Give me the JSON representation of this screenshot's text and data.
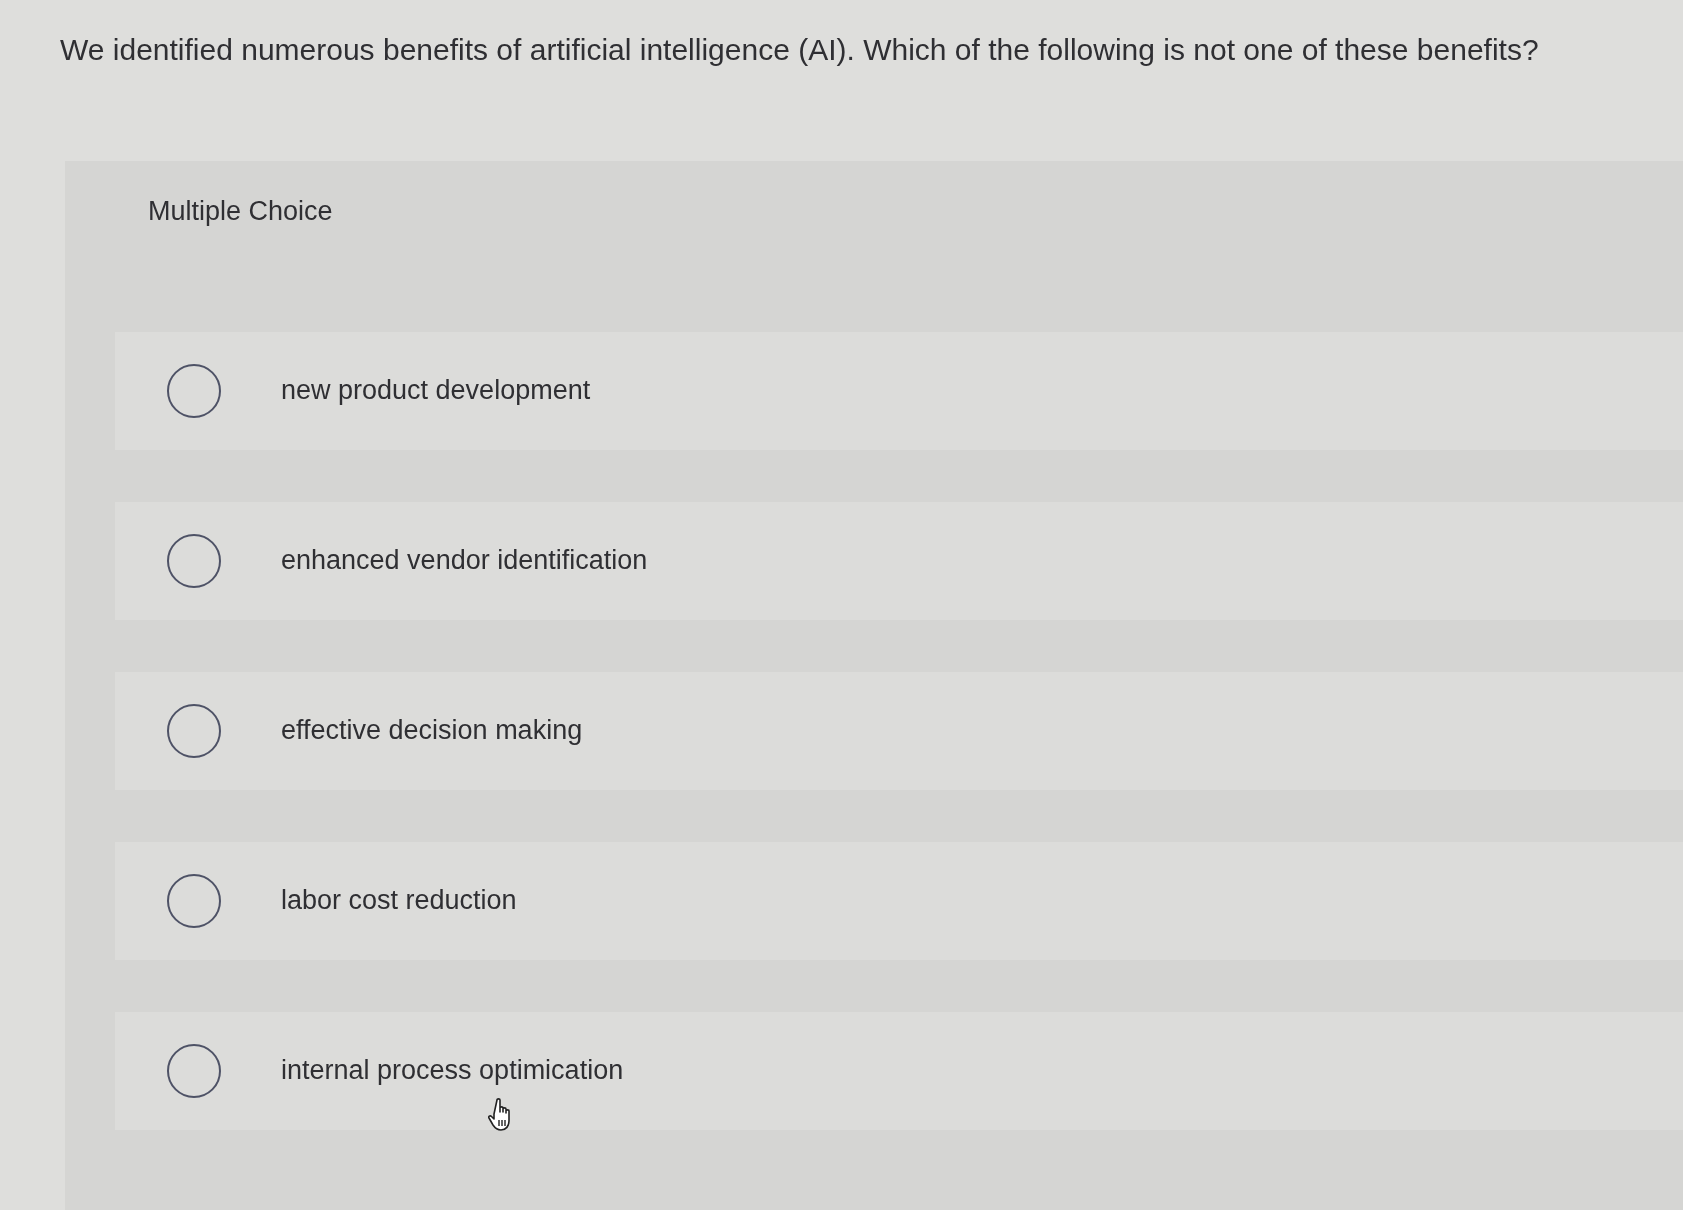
{
  "question": "We identified numerous benefits of artificial intelligence (AI). Which of the following is not one of these benefits?",
  "panel": {
    "label": "Multiple Choice"
  },
  "options": [
    {
      "label": "new product development",
      "selected": false
    },
    {
      "label": "enhanced vendor identification",
      "selected": false
    },
    {
      "label": "effective decision making",
      "selected": false
    },
    {
      "label": "labor cost reduction",
      "selected": false
    },
    {
      "label": "internal process optimication",
      "selected": false
    }
  ]
}
